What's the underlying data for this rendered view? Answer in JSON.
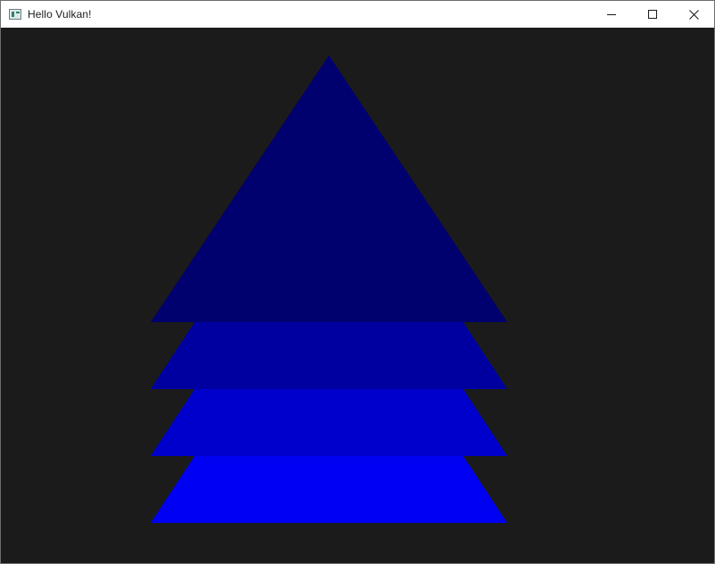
{
  "window": {
    "title": "Hello Vulkan!",
    "controls": [
      "minimize",
      "maximize",
      "close"
    ]
  },
  "icons": {
    "app": "app-window-icon",
    "minimize": "minimize-icon",
    "maximize": "maximize-icon",
    "close": "close-icon"
  },
  "scene": {
    "background": "#1b1b1b",
    "shapes": [
      {
        "name": "top-triangle",
        "color": "#00006e"
      },
      {
        "name": "band-1",
        "color": "#0000a1"
      },
      {
        "name": "band-2",
        "color": "#0000cc"
      },
      {
        "name": "band-3",
        "color": "#0000f2"
      }
    ]
  }
}
